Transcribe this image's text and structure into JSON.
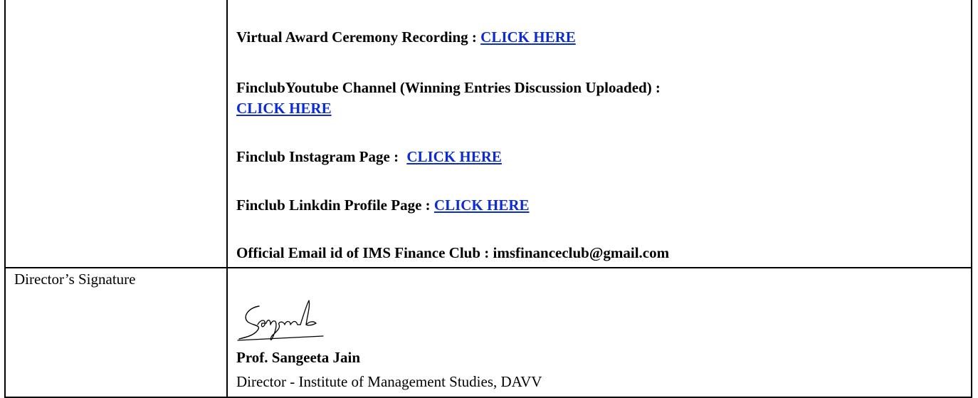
{
  "rows": {
    "links": {
      "recording": {
        "label": "Virtual Award Ceremony Recording : ",
        "link_text": "CLICK HERE"
      },
      "youtube": {
        "label": "FinclubYoutube Channel (Winning Entries Discussion Uploaded) :",
        "link_text": "CLICK HERE"
      },
      "instagram": {
        "label": "Finclub Instagram Page : ",
        "link_text": "CLICK HERE"
      },
      "linkedin": {
        "label": "Finclub Linkdin Profile Page : ",
        "link_text": "CLICK HERE"
      },
      "email": {
        "label": "Official Email id of IMS Finance Club : imsfinanceclub@gmail.com"
      }
    },
    "signature_row": {
      "left_label": "Director’s Signature",
      "signature_script": "Sangeeta",
      "name": "Prof. Sangeeta Jain",
      "designation": "Director - Institute of Management Studies, DAVV"
    }
  },
  "colors": {
    "link": "#0b2bd6",
    "border": "#000000"
  }
}
